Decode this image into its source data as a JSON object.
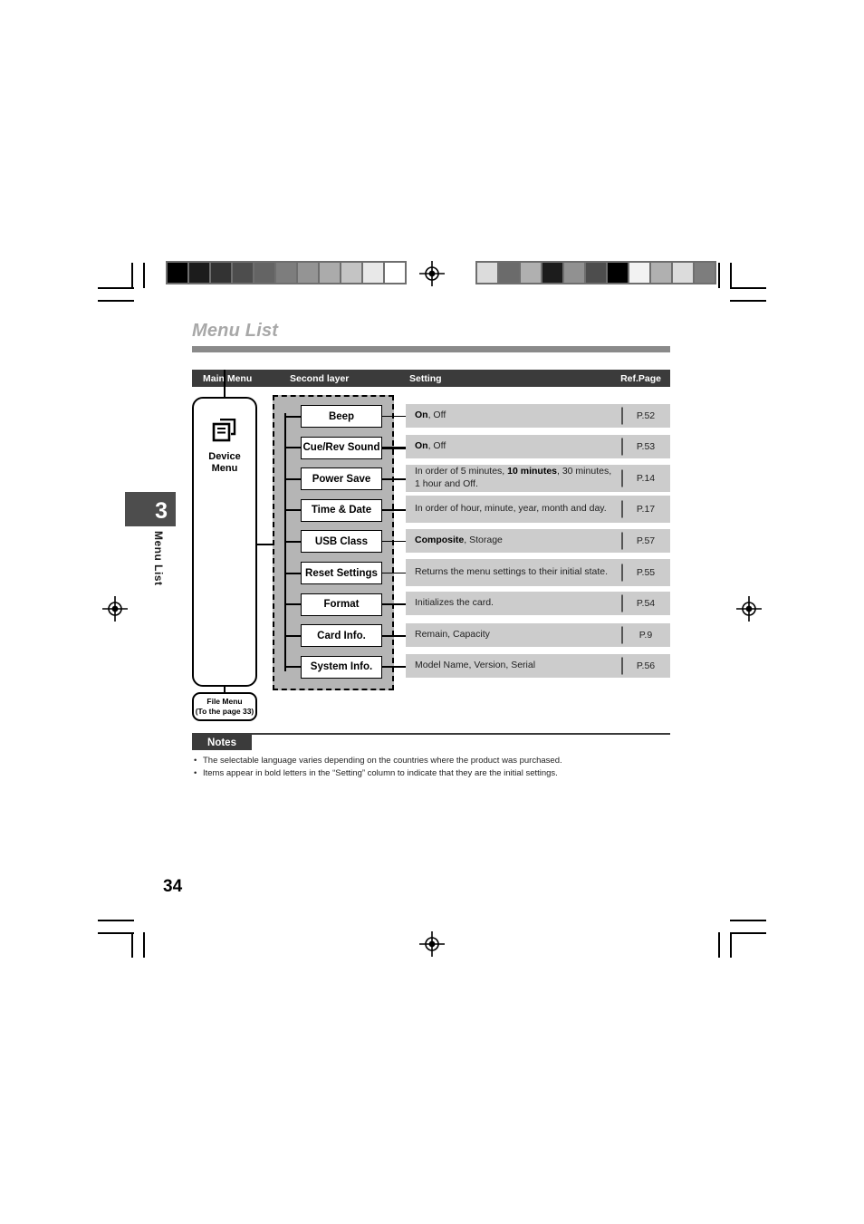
{
  "document": {
    "section_title": "Menu List",
    "page_number": "34",
    "chapter_number": "3",
    "chapter_label": "Menu List"
  },
  "table": {
    "headers": {
      "main_menu": "Main Menu",
      "second_layer": "Second layer",
      "setting": "Setting",
      "ref_page": "Ref.Page"
    }
  },
  "diagram": {
    "main_menu": {
      "icon": "document-stack-icon",
      "label_line1": "Device",
      "label_line2": "Menu"
    },
    "file_menu": {
      "label_line1": "File Menu",
      "label_line2": "(To the page 33)"
    },
    "items": [
      {
        "name": "Beep",
        "setting_plain_pre": "",
        "setting_bold": "On",
        "setting_plain_post": ", Off",
        "ref": "P.52"
      },
      {
        "name": "Cue/Rev Sound",
        "setting_plain_pre": "",
        "setting_bold": "On",
        "setting_plain_post": ", Off",
        "ref": "P.53"
      },
      {
        "name": "Power Save",
        "setting_plain_pre": "In order of 5 minutes, ",
        "setting_bold": "10 minutes",
        "setting_plain_post": ", 30 minutes, 1 hour and Off.",
        "ref": "P.14"
      },
      {
        "name": "Time & Date",
        "setting_plain_pre": "In order of hour, minute, year, month and day.",
        "setting_bold": "",
        "setting_plain_post": "",
        "ref": "P.17"
      },
      {
        "name": "USB Class",
        "setting_plain_pre": "",
        "setting_bold": "Composite",
        "setting_plain_post": ", Storage",
        "ref": "P.57"
      },
      {
        "name": "Reset Settings",
        "setting_plain_pre": "Returns the menu settings to their initial state.",
        "setting_bold": "",
        "setting_plain_post": "",
        "ref": "P.55"
      },
      {
        "name": "Format",
        "setting_plain_pre": "Initializes the card.",
        "setting_bold": "",
        "setting_plain_post": "",
        "ref": "P.54"
      },
      {
        "name": "Card Info.",
        "setting_plain_pre": "Remain, Capacity",
        "setting_bold": "",
        "setting_plain_post": "",
        "ref": "P.9"
      },
      {
        "name": "System Info.",
        "setting_plain_pre": "Model Name, Version, Serial",
        "setting_bold": "",
        "setting_plain_post": "",
        "ref": "P.56"
      }
    ]
  },
  "notes": {
    "heading": "Notes",
    "bullet": "•",
    "items": [
      "The selectable language varies depending on the countries where the product was purchased.",
      "Items appear in bold letters in the “Setting” column to indicate that they are the initial settings."
    ]
  },
  "print_marks": {
    "colorbar_left": [
      "#000000",
      "#1c1c1c",
      "#333333",
      "#4d4d4d",
      "#646464",
      "#7d7d7d",
      "#949494",
      "#ababab",
      "#c4c4c4",
      "#e8e8e8",
      "#ffffff"
    ],
    "colorbar_right": [
      "#dcdcdc",
      "#6b6b6b",
      "#b0b0b0",
      "#1c1c1c",
      "#919191",
      "#4d4d4d",
      "#000000",
      "#f2f2f2",
      "#b0b0b0",
      "#dcdcdc",
      "#7d7d7d"
    ]
  },
  "colors": {
    "header_bar": "#3b3b3b",
    "title_gray": "#a8a8a8",
    "row_gray": "#cccccc",
    "group_gray": "#b5b5b5"
  }
}
